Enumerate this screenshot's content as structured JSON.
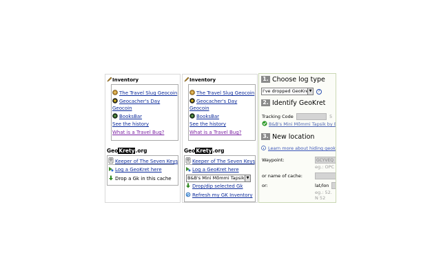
{
  "panel1": {
    "title": "Inventory",
    "items": [
      "The Travel Slug Geocoin",
      "Geocacher's Day",
      "Geocoin",
      "BooksBar"
    ],
    "history_link": "See the history",
    "travelbug_link": "What is a Travel Bug?",
    "gk_logo_a": "Geo",
    "gk_logo_b": "Krety",
    "gk_logo_c": ".org",
    "gk_items": [
      "Keeper of The Seven Keys",
      "Log a GeoKret here",
      "Drop a Gk in this cache"
    ]
  },
  "panel2": {
    "title": "Inventory",
    "items": [
      "The Travel Slug Geocoin",
      "Geocacher's Day",
      "Geocoin",
      "BooksBar"
    ],
    "history_link": "See the history",
    "travelbug_link": "What is a Travel Bug?",
    "gk_logo_a": "Geo",
    "gk_logo_b": "Krety",
    "gk_logo_c": ".org",
    "gk_items": [
      "Keeper of The Seven Keys",
      "Log a GeoKret here"
    ],
    "gk_select": "B&B's Mini Mõmmi Tapsik",
    "gk_drop": "Drop/dip selected Gk",
    "gk_refresh": "Refresh my GK Inventory"
  },
  "logpanel": {
    "step1_num": "1.",
    "step1_label": "Choose log type",
    "logtype_select": "I've dropped GeoKret",
    "help": "?",
    "step2_num": "2.",
    "step2_label": "Identify GeoKret",
    "tracking_label": "Tracking Code",
    "tracking_suffix": "5",
    "gk_found": "B&B's Mini Mõmmi Tapsik by B",
    "step3_num": "3.",
    "step3_label": "New location",
    "learn_more": "Learn more about hiding geokr",
    "waypoint_label": "Waypoint:",
    "waypoint_value": "GCYVEQ",
    "waypoint_hint": "eg.: OPC",
    "cache_name_label": "or name of cache:",
    "or_label": "or:",
    "latlon_label": "lat/lon",
    "latlon_hint1": "eg.: 52.",
    "latlon_hint2": "N 52"
  }
}
